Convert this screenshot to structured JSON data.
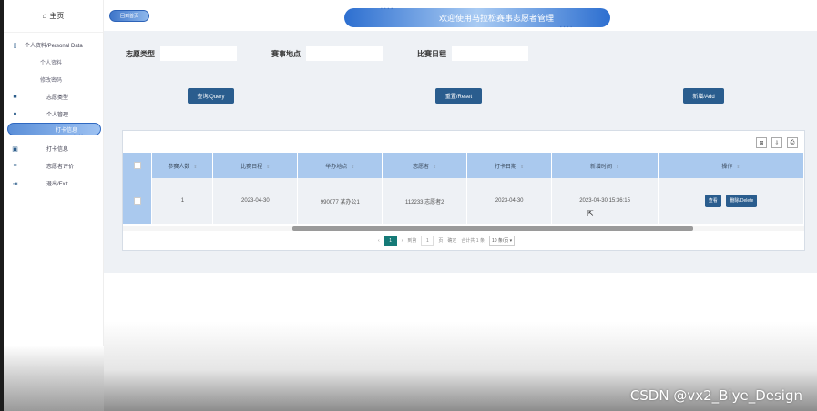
{
  "sidebar": {
    "home": "主页",
    "items": [
      {
        "label": "个人资料/Personal Data",
        "icon": "document-icon",
        "type": "group"
      },
      {
        "label": "个人资料",
        "type": "sub"
      },
      {
        "label": "修改密码",
        "type": "sub"
      },
      {
        "label": "志愿类型",
        "icon": "bookmark-icon",
        "type": "item"
      },
      {
        "label": "个人管理",
        "icon": "user-icon",
        "type": "item"
      },
      {
        "label": "打卡信息",
        "type": "active"
      },
      {
        "label": "打卡信息",
        "icon": "calendar-icon",
        "type": "item"
      },
      {
        "label": "志愿者评价",
        "icon": "chat-icon",
        "type": "item"
      },
      {
        "label": "退出/Exit",
        "icon": "exit-icon",
        "type": "item"
      }
    ]
  },
  "topbar": {
    "back_label": "回到首页",
    "title": "欢迎使用马拉松赛事志愿者管理"
  },
  "filters": [
    {
      "label": "志愿类型",
      "value": ""
    },
    {
      "label": "赛事地点",
      "value": ""
    },
    {
      "label": "比赛日程",
      "value": ""
    }
  ],
  "buttons": {
    "query": "查询/Query",
    "reset": "重置/Reset",
    "add": "新增/Add"
  },
  "table": {
    "columns": [
      "参赛人数",
      "比赛日程",
      "举办地点",
      "志愿者",
      "打卡日期",
      "新增时间",
      "操作"
    ],
    "rows": [
      {
        "cells": [
          "1",
          "2023-04-30",
          "990077 某办公1",
          "112233 志愿者2",
          "2023-04-30",
          "2023-04-30 15:36:15"
        ],
        "actions": [
          "查看",
          "删除/Delete"
        ]
      }
    ]
  },
  "pager": {
    "current": "1",
    "goto_label": "到第",
    "page_input": "1",
    "page_unit": "页",
    "confirm": "确定",
    "total": "合计共 1 条",
    "page_size": "10 条/页"
  },
  "watermark": "CSDN @vx2_Biye_Design",
  "icons": {
    "tool1": "column-filter-icon",
    "tool2": "export-icon",
    "tool3": "print-icon"
  }
}
